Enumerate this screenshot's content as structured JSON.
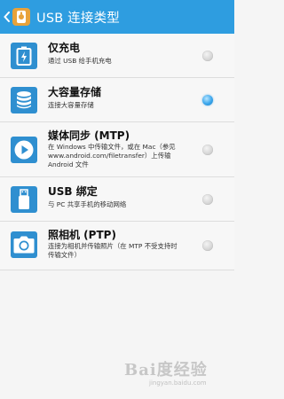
{
  "header": {
    "title": "USB 连接类型"
  },
  "options": [
    {
      "icon": "battery-charging-icon",
      "title": "仅充电",
      "description": "通过 USB 给手机充电",
      "selected": false
    },
    {
      "icon": "database-storage-icon",
      "title": "大容量存储",
      "description": "连接大容量存储",
      "selected": true
    },
    {
      "icon": "media-play-icon",
      "title": "媒体同步 (MTP)",
      "description": "在 Windows 中传输文件，或在 Mac（参见\nwww.android.com/filetransfer）上传输\nAndroid 文件",
      "selected": false
    },
    {
      "icon": "usb-modem-icon",
      "title": "USB 绑定",
      "description": "与 PC 共享手机的移动网络",
      "selected": false
    },
    {
      "icon": "camera-icon",
      "title": "照相机 (PTP)",
      "description": "连接为相机并传输照片（在 MTP 不受支持时\n传输文件）",
      "selected": false
    }
  ],
  "watermark": {
    "text": "Bai度经验",
    "sub": "jingyan.baidu.com"
  },
  "colors": {
    "header": "#2e9de0",
    "icon": "#2f8fd0",
    "radio_selected": "#3aa6ec"
  }
}
